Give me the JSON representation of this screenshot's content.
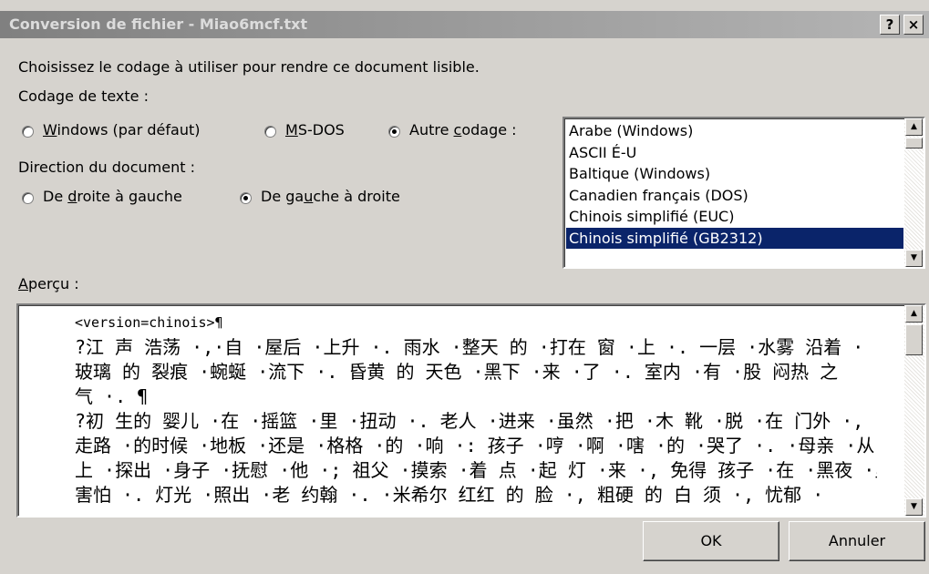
{
  "window": {
    "title": "Conversion de fichier - Miao6mcf.txt",
    "help_button": "?",
    "close_button": "×"
  },
  "instruction": "Choisissez le codage à utiliser pour rendre ce document lisible.",
  "encoding_section": {
    "label": "Codage de texte :",
    "options": [
      {
        "pre": "",
        "accel": "W",
        "post": "indows (par défaut)",
        "selected": false
      },
      {
        "pre": "",
        "accel": "M",
        "post": "S-DOS",
        "selected": false
      },
      {
        "pre": "Autre ",
        "accel": "c",
        "post": "odage :",
        "selected": true
      }
    ]
  },
  "direction_section": {
    "label": "Direction du document :",
    "options": [
      {
        "pre": "De ",
        "accel": "d",
        "post": "roite à gauche",
        "selected": false
      },
      {
        "pre": "De ga",
        "accel": "u",
        "post": "che à droite",
        "selected": true
      }
    ]
  },
  "encoding_list": {
    "items": [
      "Arabe (Windows)",
      "ASCII É-U",
      "Baltique (Windows)",
      "Canadien français (DOS)",
      "Chinois simplifié (EUC)",
      "Chinois simplifié (GB2312)"
    ],
    "selected_index": 5
  },
  "preview": {
    "label_accel": "A",
    "label_rest": "perçu :",
    "lines": [
      "<version=chinois>¶",
      "?江 声 浩荡 ·,·自 ·屋后 ·上升 ·. 雨水 ·整天 的 ·打在 窗 ·上 ·. 一层 ·水雾 沿着 ·",
      "玻璃 的 裂痕 ·蜿蜒 ·流下 ·. 昏黄 的 天色 ·黑下 ·来 ·了 ·. 室内 ·有 ·股 闷热 之",
      "气 ·. ¶",
      "?初 生的 婴儿 ·在 ·摇篮 ·里 ·扭动 ·. 老人 ·进来 ·虽然 ·把 ·木 靴 ·脱 ·在 门外 ·, ·",
      "走路 ·的时候 ·地板 ·还是 ·格格 ·的 ·响 ·: 孩子 ·哼 ·啊 ·嗐 ·的 ·哭了 ·. ·母亲 ·从 床",
      "上 ·探出 ·身子 ·抚慰 ·他 ·; 祖父 ·摸索 ·着 点 ·起 灯 ·来 ·, 免得 孩子 ·在 ·黑夜 ·里 ·",
      "害怕 ·. 灯光 ·照出 ·老 约翰 ·. ·米希尔 红红 的 脸 ·, 粗硬 的 白 须 ·, 忧郁 ·"
    ]
  },
  "buttons": {
    "ok": "OK",
    "cancel": "Annuler"
  }
}
